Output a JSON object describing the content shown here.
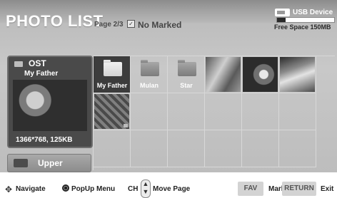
{
  "header": {
    "title": "PHOTO LIST",
    "page_info": "Page 2/3",
    "marked_status": "No Marked",
    "usb_label": "USB Device",
    "free_space": "Free Space 150MB",
    "free_fraction": 0.15
  },
  "preview": {
    "name": "OST",
    "subtitle": "My Father",
    "resolution": "1366*768, 125KB"
  },
  "nav": {
    "upper_label": "Upper"
  },
  "grid": {
    "items": [
      {
        "label": "My Father",
        "type": "folder",
        "selected": true
      },
      {
        "label": "Mulan",
        "type": "folder",
        "selected": false
      },
      {
        "label": "Star",
        "type": "folder",
        "selected": false
      },
      {
        "label": "",
        "type": "photo",
        "selected": false
      },
      {
        "label": "",
        "type": "photo",
        "selected": false
      },
      {
        "label": "",
        "type": "photo",
        "selected": false
      },
      {
        "label": "",
        "type": "photo",
        "selected": false
      }
    ]
  },
  "footer": {
    "navigate": "Navigate",
    "popup": "PopUp Menu",
    "ch": "CH",
    "move_page": "Move Page",
    "fav_key": "FAV",
    "mark": "Mark",
    "return_key": "RETURN",
    "exit": "Exit"
  },
  "icons": {
    "navigate": "arrows-icon",
    "ok": "ok-button-icon",
    "ch": "channel-rocker-icon",
    "usb": "usb-icon",
    "folder": "folder-icon"
  }
}
